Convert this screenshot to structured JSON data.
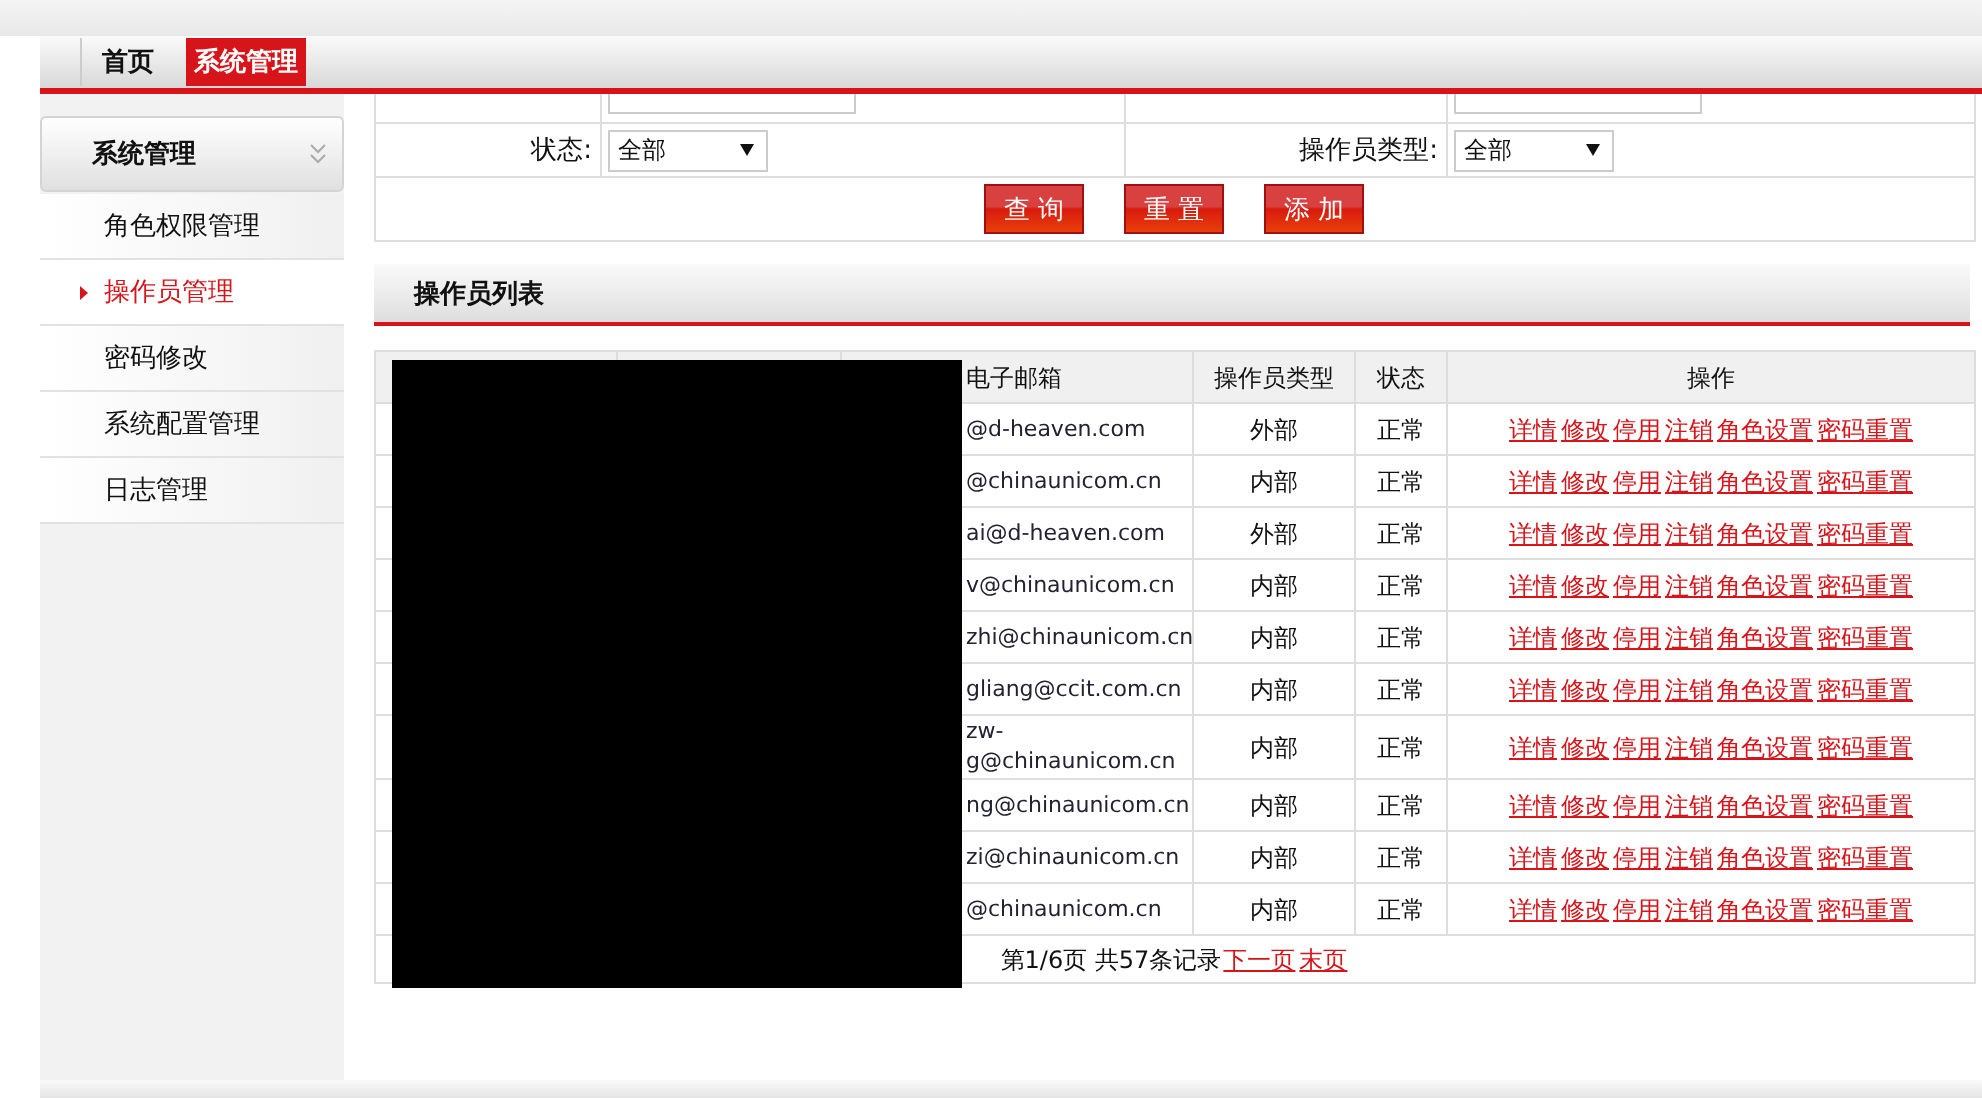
{
  "nav": {
    "tabs": [
      {
        "label": "首页",
        "selected": false
      },
      {
        "label": "系统管理",
        "selected": true
      }
    ]
  },
  "sidebar": {
    "title": "系统管理",
    "expanded": true,
    "items": [
      {
        "label": "角色权限管理",
        "selected": false
      },
      {
        "label": "操作员管理",
        "selected": true
      },
      {
        "label": "密码修改",
        "selected": false
      },
      {
        "label": "系统配置管理",
        "selected": false
      },
      {
        "label": "日志管理",
        "selected": false
      }
    ]
  },
  "search_form": {
    "rows": [
      {
        "fields": [
          {
            "kind": "text"
          },
          {
            "kind": "text"
          }
        ]
      },
      {
        "fields": [
          {
            "label": "状态:",
            "kind": "select",
            "value": "全部"
          },
          {
            "label": "操作员类型:",
            "kind": "select",
            "value": "全部"
          }
        ]
      }
    ],
    "buttons": [
      "查 询",
      "重 置",
      "添 加"
    ]
  },
  "list": {
    "title": "操作员列表",
    "columns": [
      "电子邮箱",
      "操作员类型",
      "状态",
      "操作"
    ],
    "rows": [
      {
        "email": "@d-heaven.com",
        "type": "外部",
        "status": "正常",
        "actions": [
          "详情",
          "修改",
          "停用",
          "注销",
          "角色设置",
          "密码重置"
        ]
      },
      {
        "email": "@chinaunicom.cn",
        "type": "内部",
        "status": "正常",
        "actions": [
          "详情",
          "修改",
          "停用",
          "注销",
          "角色设置",
          "密码重置"
        ]
      },
      {
        "email": "ai@d-heaven.com",
        "type": "外部",
        "status": "正常",
        "actions": [
          "详情",
          "修改",
          "停用",
          "注销",
          "角色设置",
          "密码重置"
        ]
      },
      {
        "email": "v@chinaunicom.cn",
        "type": "内部",
        "status": "正常",
        "actions": [
          "详情",
          "修改",
          "停用",
          "注销",
          "角色设置",
          "密码重置"
        ]
      },
      {
        "email": "zhi@chinaunicom.cn",
        "type": "内部",
        "status": "正常",
        "actions": [
          "详情",
          "修改",
          "停用",
          "注销",
          "角色设置",
          "密码重置"
        ]
      },
      {
        "email": "gliang@ccit.com.cn",
        "type": "内部",
        "status": "正常",
        "actions": [
          "详情",
          "修改",
          "停用",
          "注销",
          "角色设置",
          "密码重置"
        ]
      },
      {
        "email": "zw-\ng@chinaunicom.cn",
        "type": "内部",
        "status": "正常",
        "actions": [
          "详情",
          "修改",
          "停用",
          "注销",
          "角色设置",
          "密码重置"
        ]
      },
      {
        "email": "ng@chinaunicom.cn",
        "type": "内部",
        "status": "正常",
        "actions": [
          "详情",
          "修改",
          "停用",
          "注销",
          "角色设置",
          "密码重置"
        ]
      },
      {
        "email": "zi@chinaunicom.cn",
        "type": "内部",
        "status": "正常",
        "actions": [
          "详情",
          "修改",
          "停用",
          "注销",
          "角色设置",
          "密码重置"
        ]
      },
      {
        "email": "@chinaunicom.cn",
        "type": "内部",
        "status": "正常",
        "actions": [
          "详情",
          "修改",
          "停用",
          "注销",
          "角色设置",
          "密码重置"
        ]
      }
    ],
    "pagination": {
      "summary": "第1/6页 共57条记录",
      "links": [
        "下一页",
        "末页"
      ]
    }
  }
}
